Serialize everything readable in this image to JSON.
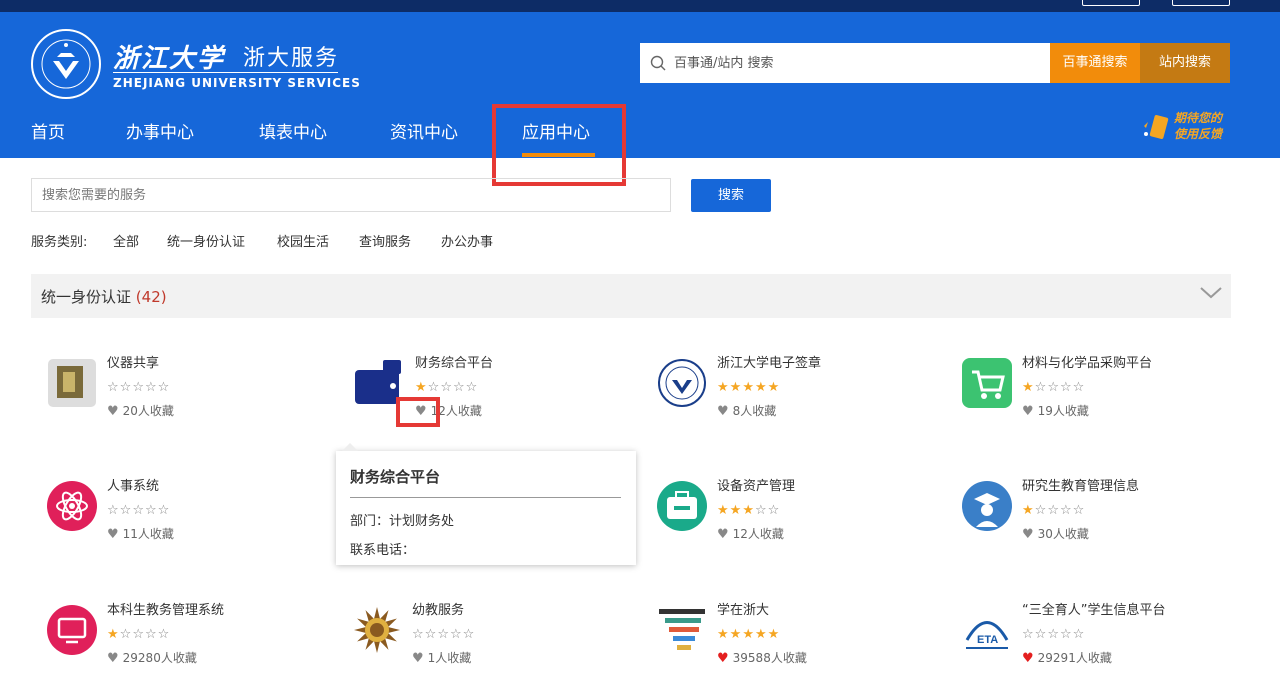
{
  "topbar": {
    "left_text": "",
    "right_btn1": "",
    "right_btn2": ""
  },
  "header": {
    "logo_cn": "浙江大学",
    "logo_sub": "浙大服务",
    "logo_en": "ZHEJIANG UNIVERSITY SERVICES",
    "search_placeholder": "百事通/站内 搜索",
    "btn_baishitong": "百事通搜索",
    "btn_site": "站内搜索",
    "feedback_line1": "期待您的",
    "feedback_line2": "使用反馈"
  },
  "nav": [
    {
      "label": "首页"
    },
    {
      "label": "办事中心"
    },
    {
      "label": "填表中心"
    },
    {
      "label": "资讯中心"
    },
    {
      "label": "应用中心"
    }
  ],
  "search": {
    "placeholder": "搜索您需要的服务",
    "button": "搜索"
  },
  "categories": {
    "label": "服务类别:",
    "items": [
      "全部",
      "统一身份认证",
      "校园生活",
      "查询服务",
      "办公办事"
    ]
  },
  "section": {
    "title": "统一身份认证",
    "count": "(42)"
  },
  "apps": [
    {
      "name": "仪器共享",
      "rating": 0,
      "favorites": "20人收藏",
      "heart": "grey",
      "icon": "instrument-icon",
      "color": "#7a6a3a"
    },
    {
      "name": "财务综合平台",
      "rating": 1,
      "favorites": "12人收藏",
      "heart": "grey",
      "icon": "wallet-icon",
      "color": "#1a2f8a"
    },
    {
      "name": "浙江大学电子签章",
      "rating": 5,
      "favorites": "8人收藏",
      "heart": "grey",
      "icon": "zju-seal-icon",
      "color": "#1a3e8a"
    },
    {
      "name": "材料与化学品采购平台",
      "rating": 1,
      "favorites": "19人收藏",
      "heart": "grey",
      "icon": "cart-icon",
      "color": "#3cc371"
    },
    {
      "name": "人事系统",
      "rating": 0,
      "favorites": "11人收藏",
      "heart": "grey",
      "icon": "atom-icon",
      "color": "#e0205a"
    },
    {
      "name": "设备资产管理",
      "rating": 3,
      "favorites": "12人收藏",
      "heart": "grey",
      "icon": "toolbox-icon",
      "color": "#1aaa8a"
    },
    {
      "name": "研究生教育管理信息",
      "rating": 1,
      "favorites": "30人收藏",
      "heart": "grey",
      "icon": "graduate-icon",
      "color": "#3a7fc8"
    },
    {
      "name": "本科生教务管理系统",
      "rating": 1,
      "favorites": "29280人收藏",
      "heart": "grey",
      "icon": "screen-icon",
      "color": "#e0205a"
    },
    {
      "name": "幼教服务",
      "rating": 0,
      "favorites": "1人收藏",
      "heart": "grey",
      "icon": "sun-icon",
      "color": "#8a5a20"
    },
    {
      "name": "学在浙大",
      "rating": 5,
      "favorites": "39588人收藏",
      "heart": "red",
      "icon": "layers-icon",
      "color": "#3a9a8a"
    },
    {
      "name": "“三全育人”学生信息平台",
      "rating": 0,
      "favorites": "29291人收藏",
      "heart": "red",
      "icon": "eta-icon",
      "color": "#1a5aa8"
    }
  ],
  "popup": {
    "title": "财务综合平台",
    "dept": "部门：计划财务处",
    "phone": "联系电话："
  }
}
